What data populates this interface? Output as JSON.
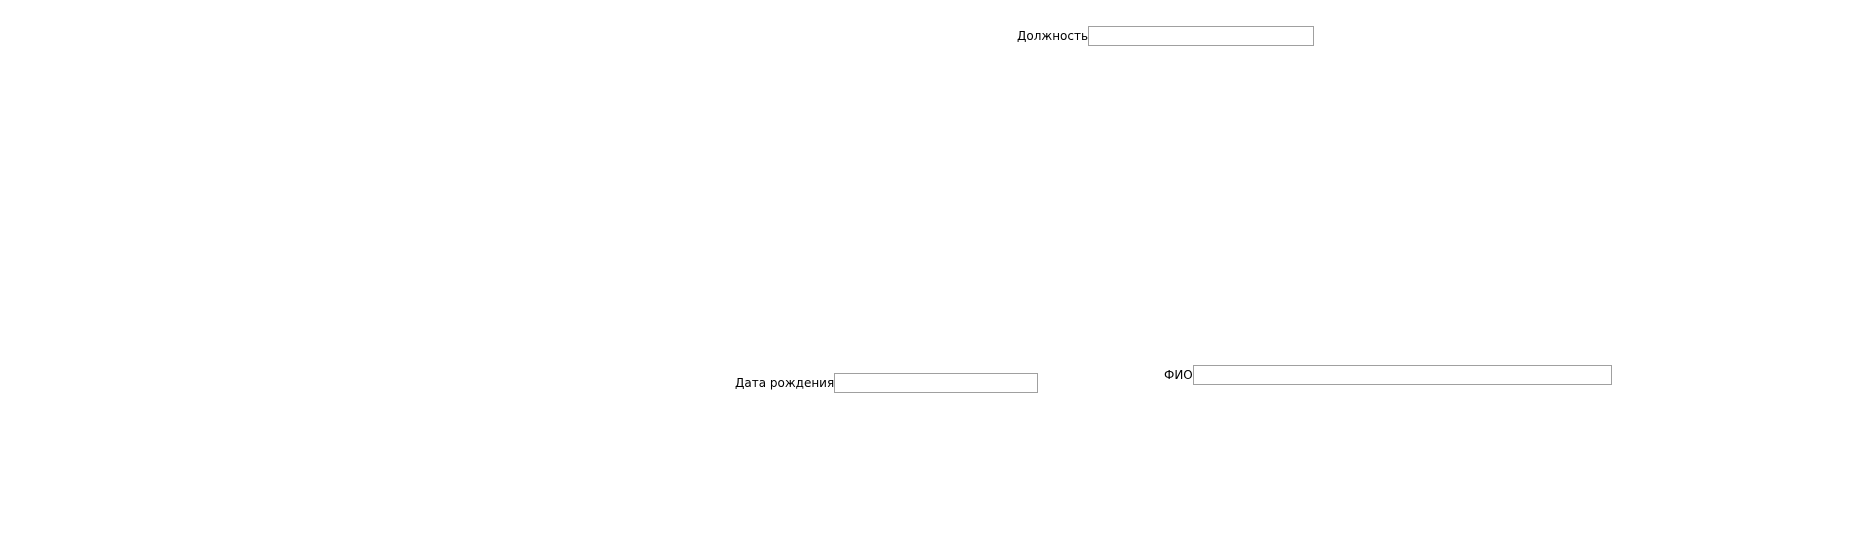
{
  "form": {
    "position": {
      "label": "Должность",
      "value": "",
      "placeholder": ""
    },
    "full_name": {
      "label": "ФИО",
      "value": "",
      "placeholder": ""
    },
    "birth_date": {
      "label": "Дата рождения",
      "value": "",
      "placeholder": ""
    }
  }
}
